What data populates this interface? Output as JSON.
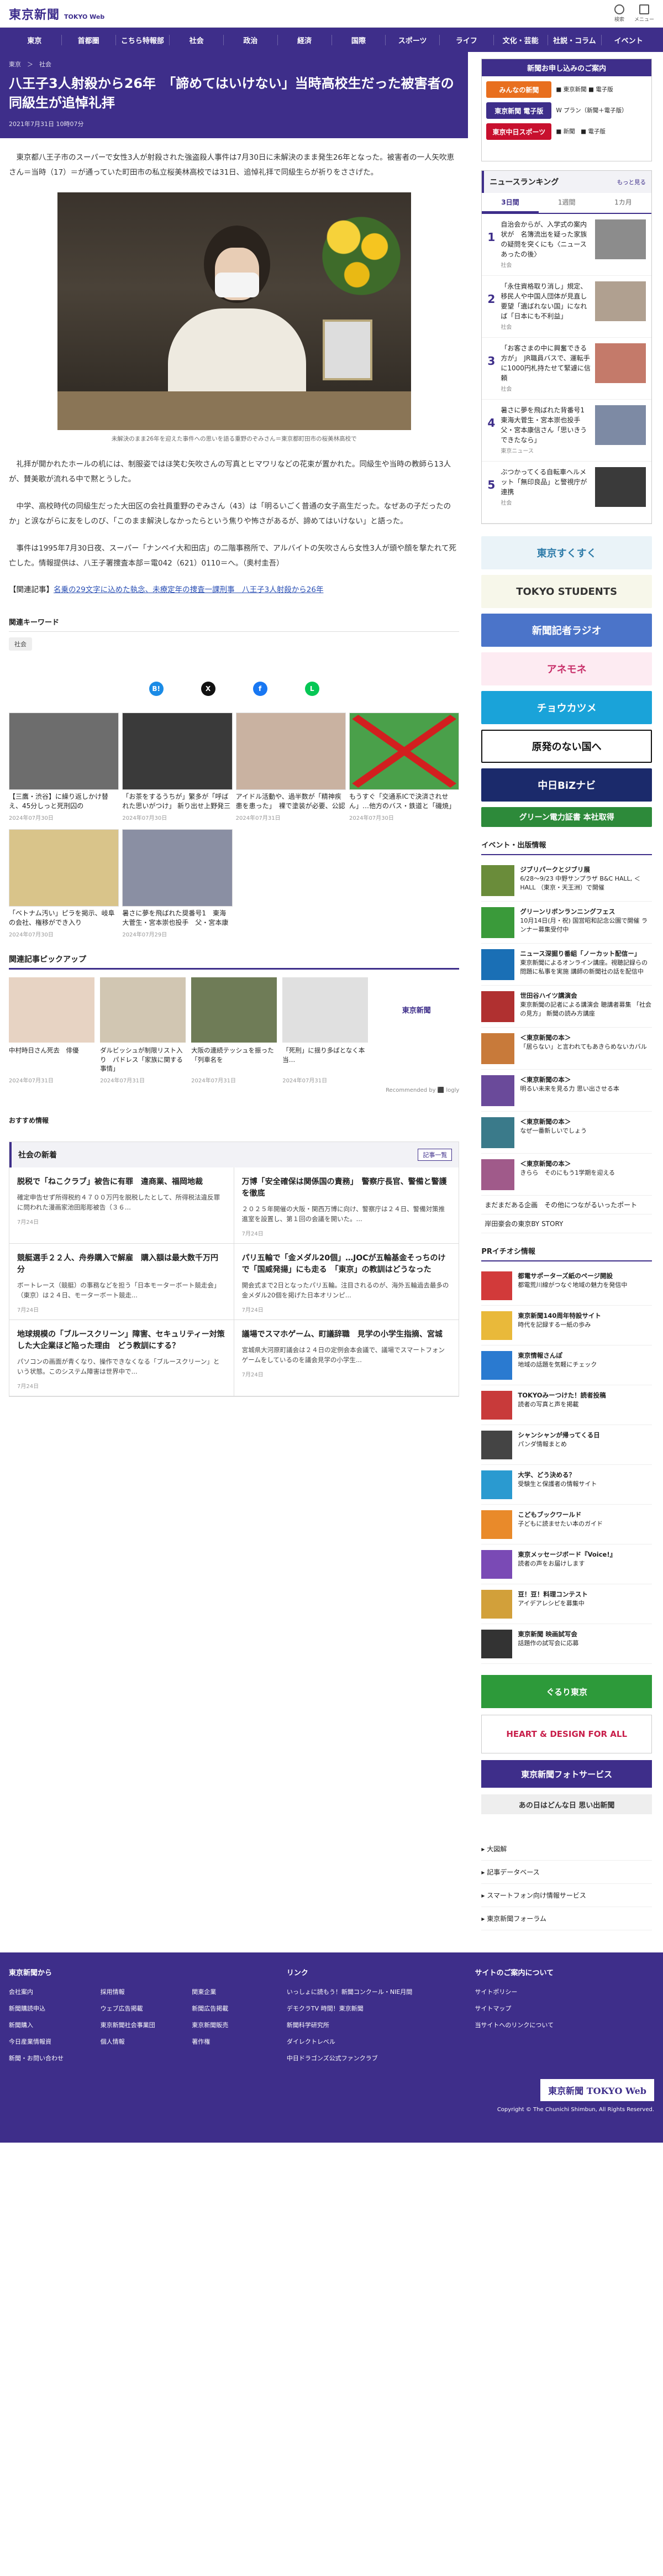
{
  "header": {
    "logo_ja": "東京新聞",
    "logo_en": "TOKYO Web",
    "icons": [
      {
        "label": "検索",
        "icon": "search-icon"
      },
      {
        "label": "メニュー",
        "icon": "menu-icon"
      }
    ]
  },
  "nav": [
    "東京",
    "首都圏",
    "こちら特報部",
    "社会",
    "政治",
    "経済",
    "国際",
    "スポーツ",
    "ライフ",
    "文化・芸能",
    "社説・コラム",
    "イベント"
  ],
  "article": {
    "breadcrumb": "東京　＞　社会",
    "title": "八王子3人射殺から26年　「諦めてはいけない」当時高校生だった被害者の同級生が追悼礼拝",
    "date": "2021年7月31日 10時07分",
    "p1": "　東京都八王子市のスーパーで女性3人が射殺された強盗殺人事件は7月30日に未解決のまま発生26年となった。被害者の一人矢吹恵さん＝当時（17）＝が通っていた町田市の私立桜美林高校では31日、追悼礼拝で同級生らが祈りをささげた。",
    "caption": "未解決のまま26年を迎えた事件への思いを語る重野のぞみさん＝東京都町田市の桜美林高校で",
    "p2": "　礼拝が開かれたホールの机には、制服姿ではほ笑む矢吹さんの写真とヒマワリなどの花束が置かれた。同級生や当時の教師ら13人が、賛美歌が流れる中で黙とうした。",
    "p3": "　中学、高校時代の同級生だった大田区の会社員重野のぞみさん（43）は「明るいごく普通の女子高生だった。なぜあの子だったのか」と涙ながらに友をしのび、「このまま解決しなかったらという焦りや怖さがあるが、諦めてはいけない」と語った。",
    "p4": "　事件は1995年7月30日夜、スーパー「ナンペイ大和田店」の二階事務所で、アルバイトの矢吹さんら女性3人が頭や顔を撃たれて死亡した。情報提供は、八王子署捜査本部＝電042（621）0110＝へ。（奥村圭吾）",
    "related_prefix": "【関連記事】",
    "related_link": "名乗の29文字に込めた執念、未療定年の捜査一課刑事　八王子3人射殺から26年"
  },
  "tags": {
    "heading": "関連キーワード",
    "items": [
      "社会"
    ]
  },
  "share": [
    {
      "label": "B!",
      "color": "#1a8be6"
    },
    {
      "label": "X",
      "color": "#111111"
    },
    {
      "label": "f",
      "color": "#1877f2"
    },
    {
      "label": "L",
      "color": "#06c755"
    }
  ],
  "related_cards": [
    {
      "title": "【三鷹・渋谷】に繰り返しかけ替え、45分しっと死刑囚の",
      "date": "2024年07月30日",
      "color": "#6d6d6d"
    },
    {
      "title": "「お茶をするうちが」繁多が「呼ばれた思いがつけ」 新り出せ上野発三原教授が決してでき",
      "date": "2024年07月30日",
      "color": "#3a3a3a"
    },
    {
      "title": "アイドル活動や、過半数が「精神疾患を患った」　裸で塗装が必要、公認ではある…100人調査",
      "date": "2024年07月31日",
      "color": "#c9b2a1"
    },
    {
      "title": "もうすぐ「交通系ICで決済されせん」…他方のバス・鉄道と「磯焼」の動き　警告商品",
      "date": "2024年07月30日",
      "color": "#4aa04a"
    },
    {
      "title": "「ベトナム汚い」ピラを掲示、岐阜の会社、権移ができ入り",
      "date": "2024年07月30日",
      "color": "#d9c48a"
    },
    {
      "title": "暑さに夢を飛ばれた奨番号1　東海大菅生・宮本崇也投手　父・宮本康信さん「悪いきう…",
      "date": "2024年07月29日",
      "color": "#8a8fa3"
    }
  ],
  "pickup": {
    "heading": "関連記事ピックアップ",
    "items": [
      {
        "title": "中村時日さん死去　俳優",
        "date": "2024年07月31日",
        "color": "#e7d3c3"
      },
      {
        "title": "ダルビッシュが制限リスト入り　パドレス「家族に関する事情」",
        "date": "2024年07月31日",
        "color": "#d1c6b2"
      },
      {
        "title": "大阪の連続テッシュを振った「列車名を",
        "date": "2024年07月31日",
        "color": "#6f7c57"
      },
      {
        "title": "「死刑」に揺り多ばとなく本当…",
        "date": "2024年07月31日",
        "color": "#e0e0e0"
      },
      {
        "title": "",
        "date": "",
        "color": "#ffffff"
      }
    ],
    "recommend": "Recommended by ⬛ logly"
  },
  "osusume": "おすすめ情報",
  "social": {
    "heading": "社会の新着",
    "more": "記事一覧",
    "items": [
      {
        "title": "脱税で「ねこクラブ」被告に有罪　違商業、福岡地裁",
        "summary": "確定申告せず所得税約４７００万円を脱税したとして、所得税法違反罪に問われた漫画家池田彫彫被告（３６...",
        "date": "7月24日"
      },
      {
        "title": "万博「安全確保は関係国の責務」　警察庁長官、警備と警護を徹底",
        "summary": "２０２５年開催の大阪・関西万博に向け、警察庁は２４日、警備対策推進室を設置し、第１回の会議を開いた。...",
        "date": "7月24日"
      },
      {
        "title": "競艇選手２２人、舟券購入で解雇　購入額は最大数千万円分",
        "summary": "ボートレース（競艇）の事務などを担う「日本モーターボート競走会」（東京）は２４日、モーターボート競走...",
        "date": "7月24日"
      },
      {
        "title": "パリ五輪で「金メダル20個」…JOCが五輪基金そっちのけで「国威発揚」にも走る　「東京」の教訓はどうなった",
        "summary": "開会式まで2日となったパリ五輪。注目されるのが、海外五輪過去最多の金メダル20個を掲げた日本オリンピ...",
        "date": "7月24日"
      },
      {
        "title": "地球規模の「ブルースクリーン」障害、セキュリティー対策した大企業ほど陥った理由　どう教訓にする？",
        "summary": "パソコンの画面が青くなり、操作できなくなる「ブルースクリーン」という状態。このシステム障害は世界中で...",
        "date": "7月24日"
      },
      {
        "title": "議場でスマホゲーム、町議辞職　見学の小学生指摘、宮城",
        "summary": "宮城県大河原町議会は２４日の定例会本会議で、議場でスマートフォンゲームをしているのを議会見学の小学生...",
        "date": "7月24日"
      }
    ]
  },
  "sidebar": {
    "subscribe": {
      "heading": "新聞お申し込みのご案内",
      "rows": [
        {
          "logo": "みんなの新聞",
          "color": "#e86f1f",
          "opts": "■ 東京新聞\n■ 電子版"
        },
        {
          "logo": "東京新聞 電子版",
          "color": "#3e2e8a",
          "opts": "W プラン（新聞＋電子版）"
        },
        {
          "logo": "東京中日スポーツ",
          "color": "#c8102e",
          "opts": "■ 新聞　■ 電子版"
        }
      ]
    },
    "ranking": {
      "heading": "ニュースランキング",
      "more": "もっと見る",
      "tabs": [
        "3日間",
        "1週間",
        "1カ月"
      ],
      "items": [
        {
          "no": "1",
          "title": "自治会からが、入学式の案内状が　名簿流出を疑った家族の疑問を突くにも〈ニュースあったの後〉",
          "cat": "社会",
          "color": "#8c8c8c"
        },
        {
          "no": "2",
          "title": "「永住資格取り消し」規定、移民人や中国人団体が見直し要望「遺ばれない国」になれば「日本にも不利益」",
          "cat": "社会",
          "color": "#b0a090"
        },
        {
          "no": "3",
          "title": "「お客さまの中に興奮できる方が」　JR職員バスで、運転手に1000円札持たせて緊遽に信頼",
          "cat": "社会",
          "color": "#c47a6a"
        },
        {
          "no": "4",
          "title": "暑さに夢を飛ばれた背番号1　東海大菅生・宮本崇也投手　父・宮本康信さん「思いきうできたなら」",
          "cat": "東京ニュース",
          "color": "#7d8aa4"
        },
        {
          "no": "5",
          "title": "ぶつかってくる自転車ヘルメット「無印良品」と警視庁が連携",
          "cat": "社会",
          "color": "#3a3a3a"
        }
      ]
    },
    "banners": [
      {
        "label": "東京すくすく",
        "bg": "#eaf3f8",
        "fg": "#2c7aa8"
      },
      {
        "label": "TOKYO STUDENTS",
        "bg": "#f7f7ea",
        "fg": "#333333"
      },
      {
        "label": "新聞記者ラジオ",
        "bg": "#4b74c9",
        "fg": "#ffffff"
      },
      {
        "label": "アネモネ",
        "bg": "#fdebf2",
        "fg": "#c8306a"
      },
      {
        "label": "チョウカツメ",
        "bg": "#1aa3d9",
        "fg": "#ffffff"
      },
      {
        "label": "原発のない国へ",
        "bg": "#ffffff",
        "fg": "#111111"
      },
      {
        "label": "中日BiZナビ",
        "bg": "#1b2a6b",
        "fg": "#ffffff"
      },
      {
        "label": "グリーン電力証書 本社取得",
        "bg": "#2d8a3a",
        "fg": "#ffffff"
      }
    ],
    "events_heading": "イベント・出版情報",
    "events": [
      {
        "title": "ジブリパークとジブリ展",
        "text": "6/28〜9/23 中野サンプラザ B&C HALL, ＜ HALL （東京・天王洲）で開催",
        "color": "#6a8c3a"
      },
      {
        "title": "グリーンリボンランニングフェス",
        "text": "10月14日(月・祝) 国営昭和記念公園で開催 ランナー募集受付中",
        "color": "#3a9a3a"
      },
      {
        "title": "ニュース深掘り番組「ノーカット配信ー」",
        "text": "東京新聞によるオンライン講座。視聴記録らの問題に私事を実施 講師の新聞社の話を配信中",
        "color": "#1a6fb5"
      },
      {
        "title": "世田谷ハイツ講演会",
        "text": "東京新聞の記者による講演会 聴講者募集 「社会の見方」 新聞の読み方講座",
        "color": "#b03030"
      },
      {
        "title": "＜東京新聞の本＞",
        "text": "「居らない」と言われてもあきらめないカバル",
        "color": "#c87a3a"
      },
      {
        "title": "＜東京新聞の本＞",
        "text": "明るい未来を見る力 思い出させる本",
        "color": "#6a4a9a"
      },
      {
        "title": "＜東京新聞の本＞",
        "text": "なぜ一番新しいでしょう",
        "color": "#3a7a8a"
      },
      {
        "title": "＜東京新聞の本＞",
        "text": "きらら　そのにもう1学期を迎える",
        "color": "#a05a8a"
      }
    ],
    "more_links": [
      "まだまだある企画　その他につながるいったポート",
      "岸田豪会の東京BY STORY"
    ],
    "pr_heading": "PRイチオシ情報",
    "pr": [
      {
        "title": "都電サポーターズ紙のページ開設",
        "text": "都電荒川線がつなぐ地域の魅力を発信中",
        "color": "#d23a3a"
      },
      {
        "title": "東京新聞140周年特設サイト",
        "text": "時代を記録する一紙の歩み",
        "color": "#e9b93a"
      },
      {
        "title": "東京情報さんぽ",
        "text": "地域の話題を気軽にチェック",
        "color": "#2a7ad0"
      },
      {
        "title": "TOKYOみーつけた！読者投稿",
        "text": "読者の写真と声を掲載",
        "color": "#c83a3a"
      },
      {
        "title": "シャンシャンが帰ってくる日",
        "text": "パンダ情報まとめ",
        "color": "#444444"
      },
      {
        "title": "大学、どう決める？",
        "text": "受験生と保護者の情報サイト",
        "color": "#2a9ad0"
      },
      {
        "title": "こどもブックワールド",
        "text": "子どもに読ませたい本のガイド",
        "color": "#e98a2a"
      },
      {
        "title": "東京メッセージボード『Voice!』",
        "text": "読者の声をお届けします",
        "color": "#7a4ab5"
      },
      {
        "title": "豆！豆！料理コンテスト",
        "text": "アイデアレシピを募集中",
        "color": "#d2a03a"
      },
      {
        "title": "東京新聞 映画試写会",
        "text": "話題作の試写会に応募",
        "color": "#333333"
      }
    ],
    "bottom_banners": [
      {
        "label": "ぐるり東京",
        "bg": "#2d9a3a",
        "fg": "#ffffff"
      },
      {
        "label": "HEART & DESIGN FOR ALL",
        "bg": "#ffffff",
        "fg": "#c81e4a"
      },
      {
        "label": "東京新聞フォトサービス",
        "bg": "#3e2e8a",
        "fg": "#ffffff"
      },
      {
        "label": "あの日はどんな日 思い出新聞",
        "bg": "#eeeeee",
        "fg": "#333333"
      }
    ],
    "accordion": [
      "大図解",
      "記事データベース",
      "スマートフォン向け情報サービス",
      "東京新聞フォーラム"
    ]
  },
  "footer": {
    "col1_heading": "東京新聞から",
    "col1": [
      "会社案内",
      "新聞購読申込",
      "新聞購入",
      "今日産業情報資",
      "新聞・お問い合わせ",
      "採用情報",
      "ウェブ広告掲載",
      "東京新聞社会事業団",
      "個人情報",
      "関東企業",
      "新聞広告掲載",
      "東京新聞販売",
      "著作権"
    ],
    "col2_heading": "リンク",
    "col2": [
      "いっしょに読もう！新聞コンクール・NIE月間",
      "デモクラTV 時間！東京新聞",
      "新聞科学研究所",
      "ダイレクトレベル",
      "中日ドラゴンズ公式ファンクラブ"
    ],
    "col3_heading": "サイトのご案内について",
    "col3": [
      "サイトポリシー",
      "サイトマップ",
      "当サイトへのリンクについて"
    ],
    "logo": "東京新聞 TOKYO Web",
    "copyright": "Copyright © The Chunichi Shimbun, All Rights Reserved."
  }
}
